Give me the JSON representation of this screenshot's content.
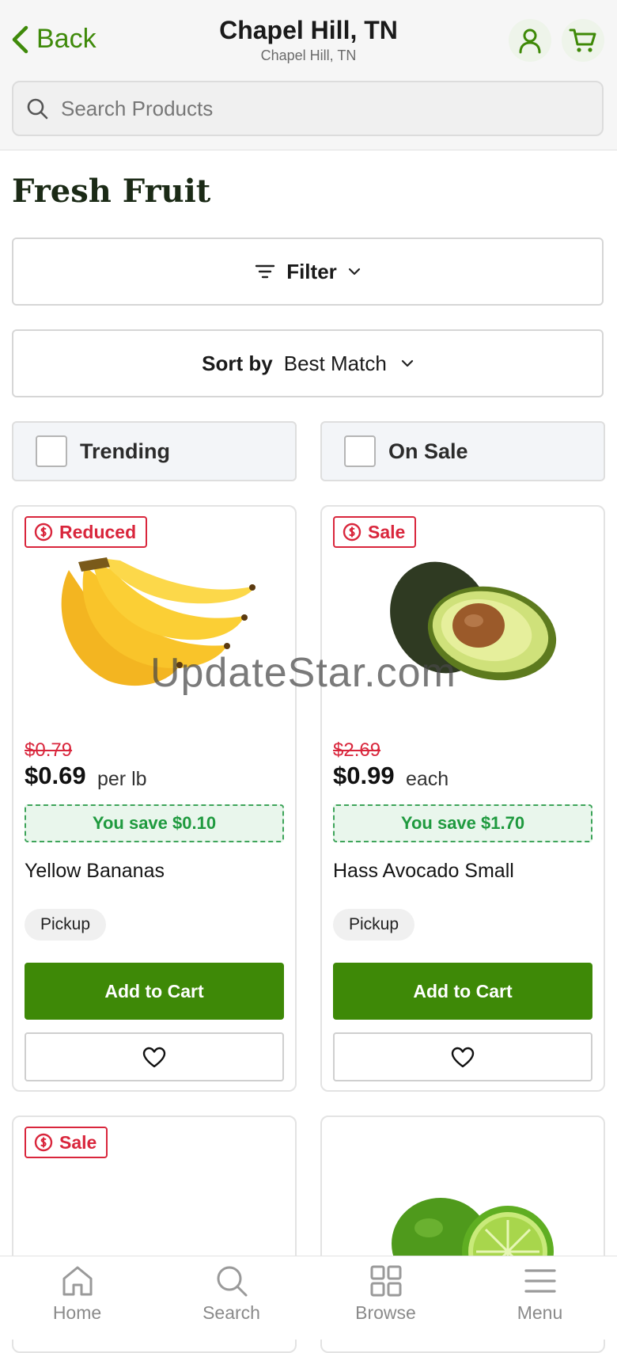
{
  "header": {
    "back_label": "Back",
    "location_title": "Chapel Hill, TN",
    "location_subtitle": "Chapel Hill, TN",
    "account_icon": "user-icon",
    "cart_icon": "cart-icon"
  },
  "search": {
    "placeholder": "Search Products"
  },
  "page_title": "Fresh Fruit",
  "filter": {
    "label": "Filter"
  },
  "sort": {
    "label": "Sort by",
    "value": "Best Match"
  },
  "checkboxes": [
    {
      "label": "Trending",
      "checked": false
    },
    {
      "label": "On Sale",
      "checked": false
    }
  ],
  "products": [
    {
      "badge": "Reduced",
      "old_price": "$0.79",
      "price": "$0.69",
      "unit": "per lb",
      "savings": "You save $0.10",
      "name": "Yellow Bananas",
      "fulfillment": "Pickup",
      "add_label": "Add to Cart"
    },
    {
      "badge": "Sale",
      "old_price": "$2.69",
      "price": "$0.99",
      "unit": "each",
      "savings": "You save $1.70",
      "name": "Hass Avocado Small",
      "fulfillment": "Pickup",
      "add_label": "Add to Cart"
    },
    {
      "badge": "Sale"
    },
    {}
  ],
  "watermark": "UpdateStar.com",
  "bottom_nav": [
    {
      "label": "Home",
      "icon": "home-icon"
    },
    {
      "label": "Search",
      "icon": "search-icon"
    },
    {
      "label": "Browse",
      "icon": "grid-icon"
    },
    {
      "label": "Menu",
      "icon": "menu-icon"
    }
  ],
  "colors": {
    "brand_green": "#3e8907",
    "sale_red": "#d9263c",
    "savings_green": "#1f9a3f"
  }
}
